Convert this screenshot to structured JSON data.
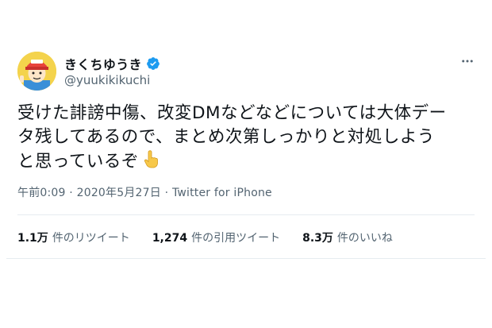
{
  "tweet": {
    "display_name": "きくちゆうき",
    "handle": "@yuukikikuchi",
    "text_lines": [
      "受けた誹謗中傷、改変DMなどなどについては大体デー",
      "タ残してあるので、まとめ次第しっかりと対処しよう",
      "と思っているぞ"
    ],
    "time": "午前0:09",
    "separator": "·",
    "date": "2020年5月27日",
    "source": "Twitter for iPhone",
    "stats": {
      "retweets_count": "1.1万",
      "retweets_label": "件のリツイート",
      "quotes_count": "1,274",
      "quotes_label": "件の引用ツイート",
      "likes_count": "8.3万",
      "likes_label": "件のいいね"
    }
  },
  "icons": {
    "verified": "verified-badge-icon",
    "more": "more-options-icon",
    "emoji": "pointing-up-emoji"
  },
  "colors": {
    "verified_blue": "#1d9bf0",
    "secondary_text": "#536471",
    "primary_text": "#0f1419"
  }
}
